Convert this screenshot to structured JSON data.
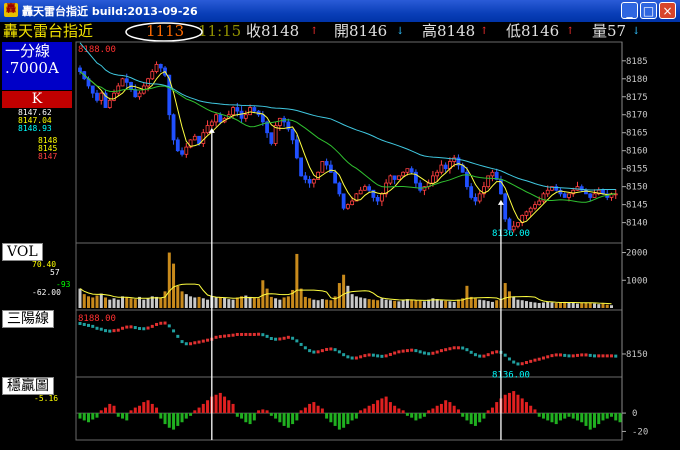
{
  "window": {
    "title": "轟天雷台指近 build:2013-09-26",
    "min": "_",
    "max": "□",
    "close": "×"
  },
  "quote": [
    {
      "text": "轟天雷台指近",
      "color": "#f0e000"
    },
    {
      "text": "1113",
      "color": "#ff6a00"
    },
    {
      "text": "11:15",
      "color": "#909000"
    },
    {
      "text": "收8148",
      "color": "#e0e0e0"
    },
    {
      "text": "↑",
      "color": "#ff3030"
    },
    {
      "text": "開8146",
      "color": "#e0e0e0"
    },
    {
      "text": "↓",
      "color": "#30c0ff"
    },
    {
      "text": "高8148",
      "color": "#e0e0e0"
    },
    {
      "text": "↑",
      "color": "#ff3030"
    },
    {
      "text": "低8146",
      "color": "#e0e0e0"
    },
    {
      "text": "↑",
      "color": "#ff3030"
    },
    {
      "text": "量57",
      "color": "#e0e0e0"
    },
    {
      "text": "↓",
      "color": "#30c0ff"
    }
  ],
  "sidebar": {
    "period": "一分線",
    "interval": ".7000A",
    "kline_label": "K",
    "ma_values": [
      {
        "text": "8147.62",
        "color": "#ffffff"
      },
      {
        "text": "8147.04",
        "color": "#ffff00"
      },
      {
        "text": "8148.93",
        "color": "#00ffff"
      }
    ],
    "alt_values": [
      {
        "text": "8148",
        "color": "#ffff00"
      },
      {
        "text": "8145",
        "color": "#ffff00"
      },
      {
        "text": "8147",
        "color": "#ff4040"
      }
    ],
    "vol_label": "VOL",
    "vol_values": [
      {
        "text": "70.40",
        "color": "#ffff00"
      },
      {
        "text": "57",
        "color": "#ffffff"
      },
      {
        "text": "-93",
        "color": "#00ff00"
      },
      {
        "text": "-62.00",
        "color": "#ffffff"
      }
    ],
    "three_label": "三陽線",
    "win_label": "穩贏圖",
    "win_value": "-5.16"
  },
  "chart_data": [
    {
      "type": "candlestick",
      "title": "K",
      "ylim": [
        8136,
        8188
      ],
      "yticks": [
        8140,
        8145,
        8150,
        8155,
        8160,
        8165,
        8170,
        8175,
        8180,
        8185
      ],
      "top_label": "8188.00",
      "low_label": "8136.00",
      "close_path": [
        8182,
        8180,
        8178,
        8176,
        8174,
        8176,
        8172,
        8174,
        8176,
        8178,
        8180,
        8179,
        8177,
        8175,
        8176,
        8178,
        8180,
        8182,
        8184,
        8183,
        8181,
        8170,
        8163,
        8160,
        8159,
        8161,
        8163,
        8164,
        8162,
        8165,
        8167,
        8168,
        8170,
        8168,
        8169,
        8170,
        8172,
        8171,
        8169,
        8170,
        8172,
        8171,
        8170,
        8168,
        8165,
        8162,
        8167,
        8169,
        8168,
        8166,
        8163,
        8158,
        8153,
        8152,
        8151,
        8152,
        8154,
        8157,
        8156,
        8154,
        8151,
        8148,
        8144,
        8145,
        8146,
        8148,
        8149,
        8150,
        8149,
        8147,
        8146,
        8148,
        8151,
        8153,
        8152,
        8153,
        8154,
        8155,
        8154,
        8151,
        8149,
        8150,
        8151,
        8153,
        8154,
        8156,
        8155,
        8157,
        8158,
        8156,
        8154,
        8150,
        8147,
        8146,
        8148,
        8150,
        8153,
        8154,
        8152,
        8148,
        8141,
        8138,
        8139,
        8140,
        8142,
        8143,
        8144,
        8145,
        8146,
        8148,
        8149,
        8150,
        8149,
        8148,
        8147,
        8148,
        8149,
        8150,
        8149,
        8148,
        8147,
        8148,
        8149,
        8148,
        8147,
        8148,
        8148
      ]
    },
    {
      "type": "bar",
      "title": "VOL",
      "ylim": [
        0,
        2200
      ],
      "yticks": [
        1000,
        2000
      ],
      "values": [
        700,
        500,
        420,
        380,
        450,
        520,
        380,
        300,
        350,
        300,
        420,
        380,
        350,
        320,
        400,
        300,
        350,
        420,
        400,
        380,
        600,
        2000,
        1600,
        800,
        600,
        500,
        420,
        380,
        400,
        350,
        300,
        420,
        380,
        400,
        360,
        320,
        300,
        380,
        420,
        450,
        400,
        380,
        350,
        1000,
        700,
        400,
        350,
        300,
        380,
        420,
        650,
        1950,
        700,
        400,
        350,
        300,
        280,
        320,
        300,
        280,
        420,
        900,
        1200,
        800,
        500,
        420,
        380,
        350,
        320,
        300,
        280,
        350,
        300,
        280,
        260,
        240,
        300,
        320,
        300,
        280,
        260,
        240,
        300,
        350,
        320,
        280,
        260,
        240,
        220,
        300,
        350,
        800,
        400,
        350,
        300,
        280,
        250,
        220,
        280,
        300,
        900,
        600,
        400,
        300,
        280,
        250,
        220,
        200,
        180,
        200,
        220,
        200,
        180,
        200,
        220,
        200,
        180,
        160,
        180,
        200,
        180,
        160,
        140,
        160,
        120,
        100
      ]
    },
    {
      "type": "line",
      "title": "三陽線",
      "ylim": [
        8130,
        8192
      ],
      "yticks": [
        8150
      ],
      "top_label": "8188.00",
      "low_label": "8136.00"
    },
    {
      "type": "bar",
      "title": "穩贏圖",
      "ylim": [
        -25,
        35
      ],
      "yticks": [
        0,
        -20
      ],
      "values": [
        -6,
        -8,
        -10,
        -7,
        -5,
        3,
        6,
        10,
        8,
        -4,
        -6,
        -8,
        3,
        6,
        8,
        12,
        14,
        10,
        6,
        -6,
        -12,
        -16,
        -18,
        -14,
        -10,
        -6,
        -3,
        3,
        6,
        10,
        14,
        18,
        20,
        22,
        18,
        14,
        10,
        -4,
        -6,
        -10,
        -12,
        -8,
        3,
        4,
        3,
        -3,
        -6,
        -10,
        -14,
        -16,
        -12,
        -8,
        3,
        6,
        10,
        12,
        8,
        5,
        -6,
        -10,
        -14,
        -18,
        -16,
        -12,
        -8,
        -6,
        3,
        5,
        8,
        10,
        14,
        16,
        18,
        12,
        8,
        5,
        3,
        -3,
        -5,
        -8,
        -6,
        -4,
        3,
        5,
        8,
        10,
        14,
        12,
        8,
        4,
        -4,
        -8,
        -12,
        -14,
        -10,
        -6,
        3,
        6,
        12,
        16,
        20,
        22,
        24,
        20,
        16,
        12,
        8,
        4,
        -4,
        -6,
        -8,
        -10,
        -12,
        -8,
        -6,
        -4,
        -6,
        -8,
        -10,
        -14,
        -18,
        -16,
        -12,
        -8,
        -6,
        -4,
        -8,
        -10
      ]
    }
  ],
  "markers_at": [
    31,
    99,
    145,
    190,
    228
  ]
}
